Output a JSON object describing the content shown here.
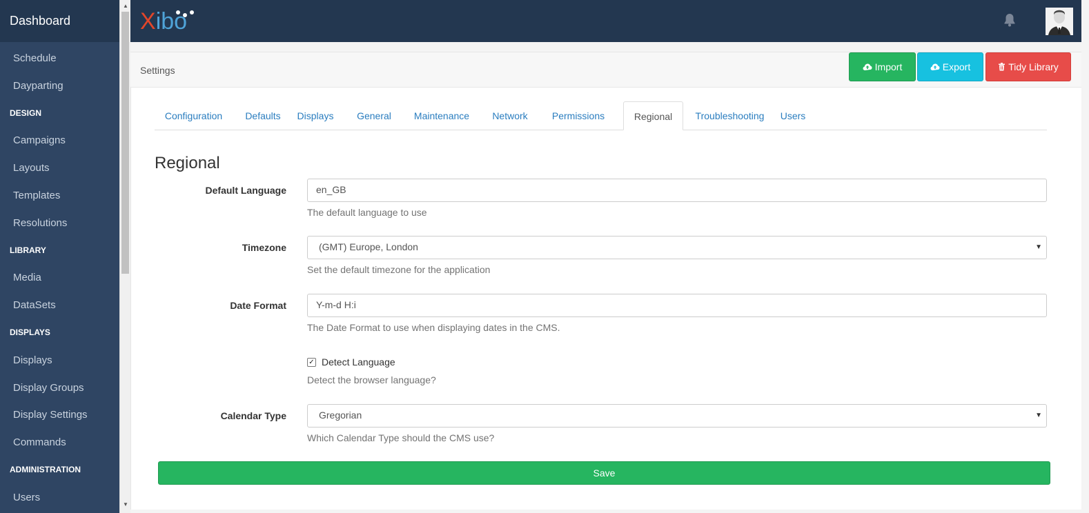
{
  "sidebar": {
    "brand": "Dashboard",
    "items_top": [
      "Schedule",
      "Dayparting"
    ],
    "design_heading": "DESIGN",
    "design_items": [
      "Campaigns",
      "Layouts",
      "Templates",
      "Resolutions"
    ],
    "library_heading": "LIBRARY",
    "library_items": [
      "Media",
      "DataSets"
    ],
    "displays_heading": "DISPLAYS",
    "displays_items": [
      "Displays",
      "Display Groups",
      "Display Settings",
      "Commands"
    ],
    "admin_heading": "ADMINISTRATION",
    "admin_items": [
      "Users"
    ]
  },
  "topbar": {
    "logo_x": "X",
    "logo_rest": "ibo",
    "bell_icon": "bell-icon",
    "avatar_icon": "user-avatar"
  },
  "header": {
    "title": "Settings",
    "import_label": "Import",
    "export_label": "Export",
    "tidy_label": "Tidy Library"
  },
  "tabs": [
    "Configuration",
    "Defaults",
    "Displays",
    "General",
    "Maintenance",
    "Network",
    "Permissions",
    "Regional",
    "Troubleshooting",
    "Users"
  ],
  "active_tab": "Regional",
  "form": {
    "section_title": "Regional",
    "default_language": {
      "label": "Default Language",
      "value": "en_GB",
      "help": "The default language to use"
    },
    "timezone": {
      "label": "Timezone",
      "value": "(GMT) Europe, London",
      "help": "Set the default timezone for the application"
    },
    "date_format": {
      "label": "Date Format",
      "value": "Y-m-d H:i",
      "help": "The Date Format to use when displaying dates in the CMS."
    },
    "detect_language": {
      "label": "Detect Language",
      "checked": true,
      "help": "Detect the browser language?"
    },
    "calendar_type": {
      "label": "Calendar Type",
      "value": "Gregorian",
      "help": "Which Calendar Type should the CMS use?"
    },
    "save_label": "Save"
  },
  "colors": {
    "sidebar_bg": "#2f4563",
    "topbar_bg": "#233750",
    "success": "#26b560",
    "info": "#17c1e0",
    "danger": "#e74c49",
    "link": "#2a7dbf"
  }
}
